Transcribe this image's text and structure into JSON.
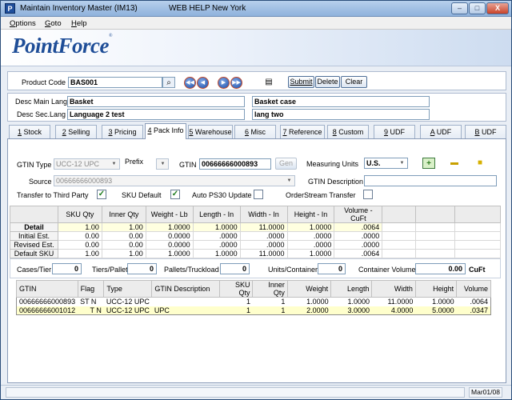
{
  "window": {
    "title": "Maintain Inventory Master (IM13)",
    "web_help": "WEB HELP",
    "location": "New York",
    "minimize": "–",
    "maximize": "□",
    "close": "X"
  },
  "menu": [
    {
      "label": "Options"
    },
    {
      "label": "Goto"
    },
    {
      "label": "Help"
    }
  ],
  "brand": {
    "name": "PointForce",
    "tm": "®"
  },
  "header": {
    "product_code_label": "Product Code",
    "product_code": "BAS001",
    "submit": "Submit",
    "delete": "Delete",
    "clear": "Clear",
    "desc_main_label": "Desc Main Lang",
    "desc_main_1": "Basket",
    "desc_main_2": "Basket case",
    "desc_sec_label": "Desc Sec.Lang",
    "desc_sec_1": "Language 2 test",
    "desc_sec_2": "lang two"
  },
  "tabs": [
    {
      "key": "1",
      "label": " Stock"
    },
    {
      "key": "2",
      "label": " Selling"
    },
    {
      "key": "3",
      "label": " Pricing"
    },
    {
      "key": "4",
      "label": " Pack Info"
    },
    {
      "key": "5",
      "label": " Warehouse"
    },
    {
      "key": "6",
      "label": " Misc"
    },
    {
      "key": "7",
      "label": " Reference"
    },
    {
      "key": "8",
      "label": " Custom"
    },
    {
      "key": "9",
      "label": " UDF"
    },
    {
      "key": "A",
      "label": " UDF"
    },
    {
      "key": "B",
      "label": " UDF"
    }
  ],
  "pack": {
    "gtin_type_label": "GTIN Type",
    "gtin_type": "UCC-12 UPC",
    "prefix_label": "Prefix",
    "prefix": "",
    "gtin_label": "GTIN",
    "gtin": "00666666000893",
    "gen": "Gen",
    "measuring_units_label": "Measuring Units",
    "measuring_units": "U.S.",
    "source_label": "Source",
    "source": "00666666000893",
    "gtin_desc_label": "GTIN Description",
    "gtin_desc": "",
    "transfer_third_label": "Transfer to Third Party",
    "transfer_third": true,
    "sku_default_label": "SKU Default",
    "sku_default": true,
    "auto_ps30_label": "Auto PS30 Update",
    "auto_ps30": false,
    "orderstream_label": "OrderStream Transfer",
    "orderstream": false
  },
  "grid1": {
    "headers": [
      "",
      "SKU Qty",
      "Inner Qty",
      "Weight - Lb",
      "Length - In",
      "Width - In",
      "Height - In",
      "Volume - CuFt",
      "",
      "",
      ""
    ],
    "rows": [
      {
        "label": "Detail",
        "cells": [
          "1.00",
          "1.00",
          "1.0000",
          "1.0000",
          "11.0000",
          "1.0000",
          ".0064"
        ]
      },
      {
        "label": "Initial Est.",
        "cells": [
          "0.00",
          "0.00",
          "0.0000",
          ".0000",
          ".0000",
          ".0000",
          ".0000"
        ]
      },
      {
        "label": "Revised Est.",
        "cells": [
          "0.00",
          "0.00",
          "0.0000",
          ".0000",
          ".0000",
          ".0000",
          ".0000"
        ]
      },
      {
        "label": "Default SKU",
        "cells": [
          "1.00",
          "1.00",
          "1.0000",
          "1.0000",
          "11.0000",
          "1.0000",
          ".0064"
        ]
      }
    ]
  },
  "totals": {
    "cases_tier_label": "Cases/Tier",
    "cases_tier": "0",
    "tiers_pallet_label": "Tiers/Pallet",
    "tiers_pallet": "0",
    "pallets_truck_label": "Pallets/Truckload",
    "pallets_truck": "0",
    "units_container_label": "Units/Container",
    "units_container": "0",
    "container_volume_label": "Container Volume",
    "container_volume": "0.00",
    "container_unit": "CuFt"
  },
  "grid2": {
    "headers": [
      "GTIN",
      "Flag",
      "Type",
      "GTIN Description",
      "SKU Qty",
      "Inner Qty",
      "Weight",
      "Length",
      "Width",
      "Height",
      "Volume"
    ],
    "rows": [
      [
        "00666666000893",
        "ST N",
        "UCC-12 UPC",
        "",
        "1",
        "1",
        "1.0000",
        "1.0000",
        "11.0000",
        "1.0000",
        ".0064"
      ],
      [
        "00666666001012",
        "T N",
        "UCC-12 UPC",
        "UPC",
        "1",
        "1",
        "2.0000",
        "3.0000",
        "4.0000",
        "5.0000",
        ".0347"
      ]
    ]
  },
  "status": {
    "date": "Mar01/08"
  },
  "colors": {
    "accent": "#1e4d97",
    "highlight_row": "#ffffcc"
  }
}
